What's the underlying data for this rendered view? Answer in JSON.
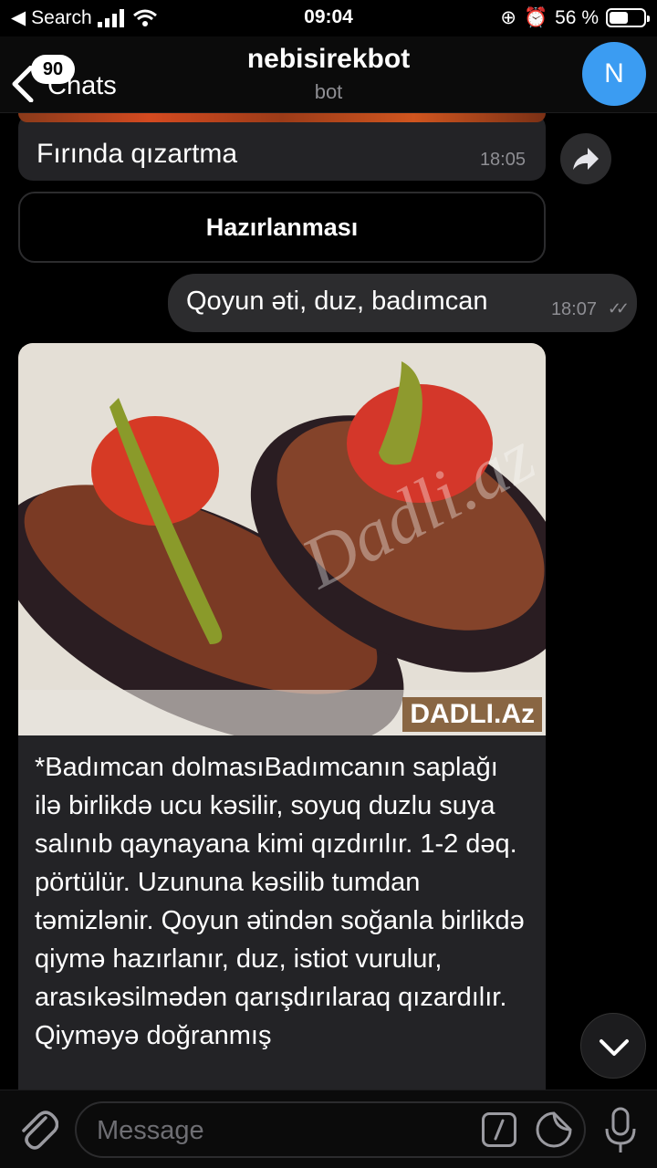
{
  "status": {
    "back_app": "Search",
    "time": "09:04",
    "battery": "56 %",
    "battery_level": 0.56
  },
  "header": {
    "back_label": "Chats",
    "unread_count": "90",
    "title": "nebisirekbot",
    "subtitle": "bot",
    "avatar_letter": "N"
  },
  "messages": {
    "m1": {
      "text": "Fırında qızartma",
      "time": "18:05"
    },
    "button": {
      "label": "Hazırlanması"
    },
    "out": {
      "text": "Qoyun əti, duz, badımcan",
      "time": "18:07",
      "checks": "✓✓"
    },
    "m2": {
      "watermark": "DADLI.Az",
      "photo_overlay": "Dadli.az",
      "text": "*Badımcan dolmasıBadımcanın saplağı ilə birlikdə ucu kəsilir, soyuq duzlu suya salınıb qaynayana kimi qızdırılır. 1-2 dəq. pörtülür. Uzununa kəsilib tumdan təmizlənir. Qoyun ətindən soğanla birlikdə qiymə hazırlanır, duz, istiot vurulur, arasıkəsilmədən qarışdırılaraq qızardılır. Qiyməyə doğranmış"
    }
  },
  "input": {
    "placeholder": "Message"
  },
  "colors": {
    "avatar": "#3b9cf2",
    "bubble_in": "#232326",
    "bubble_out": "#2c2c2e"
  }
}
